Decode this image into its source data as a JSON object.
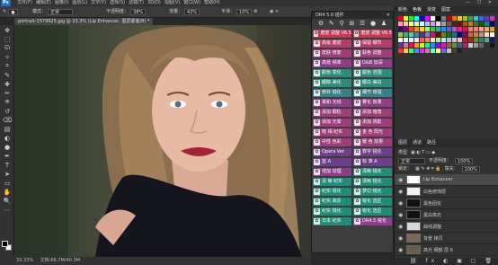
{
  "menubar": {
    "logo": "Ps",
    "items": [
      "文件(F)",
      "编辑(E)",
      "图像(I)",
      "图层(L)",
      "文字(Y)",
      "选择(S)",
      "滤镜(T)",
      "3D(D)",
      "视图(V)",
      "窗口(W)",
      "帮助(H)"
    ],
    "window_controls": "— ☐ ✕"
  },
  "optionsbar": {
    "mode_label": "模式：",
    "mode_value": "正常",
    "opacity_label": "不透明度：",
    "opacity_value": "38%",
    "flow_label": "流量：",
    "flow_value": "42%",
    "smooth_label": "平滑：",
    "smooth_value": "10%"
  },
  "document": {
    "tab_title": "portrait-1579925.jpg @ 33.3% (Lip Enhancer, 图层蒙版/8) *",
    "status_zoom": "33.33%",
    "status_doc": "文档:66.7M/40.3M"
  },
  "toolbar": {
    "tools": [
      "move-tool",
      "marquee-tool",
      "lasso-tool",
      "magic-wand-tool",
      "crop-tool",
      "eyedropper-tool",
      "healing-tool",
      "brush-tool",
      "stamp-tool",
      "history-brush-tool",
      "eraser-tool",
      "gradient-tool",
      "blur-tool",
      "dodge-tool",
      "pen-tool",
      "text-tool",
      "path-select-tool",
      "shape-tool",
      "hand-tool",
      "zoom-tool",
      "more-tool"
    ],
    "glyphs": [
      "✥",
      "⬚",
      "ᘏ",
      "✧",
      "⌗",
      "✎",
      "✚",
      "✏",
      "⎈",
      "↺",
      "⌫",
      "▤",
      "◐",
      "●",
      "✒",
      "T",
      "➤",
      "▭",
      "✋",
      "🔍",
      "⋯"
    ]
  },
  "plugin": {
    "title": "DR4 5.0 插件",
    "close": "✕",
    "top_icons": [
      "⚙",
      "✎",
      "⚲",
      "⊞",
      "☰",
      "●",
      "♟"
    ],
    "buttons": [
      {
        "label": "磨皮 调整 V6.5",
        "icon": "✿",
        "color": "#c03a58"
      },
      {
        "label": "磨皮 调整 V6.5",
        "icon": "✿",
        "color": "#c03a58"
      },
      {
        "label": "高级 磨皮",
        "icon": "✿",
        "color": "#b33d6a"
      },
      {
        "label": "保留 细节",
        "icon": "✿",
        "color": "#b33d6a"
      },
      {
        "label": "皮肤 修复",
        "icon": "✿",
        "color": "#9d3d7a"
      },
      {
        "label": "肤色 调整",
        "icon": "✿",
        "color": "#9d3d7a"
      },
      {
        "label": "高低 频率",
        "icon": "✿",
        "color": "#8e3e86"
      },
      {
        "label": "D&B 加深",
        "icon": "✿",
        "color": "#8e3e86"
      },
      {
        "label": "颜色 变化",
        "icon": "✿",
        "color": "#2a8d7c"
      },
      {
        "label": "颜色 范围",
        "icon": "✿",
        "color": "#2a8d7c"
      },
      {
        "label": "眼睛 美化",
        "icon": "✿",
        "color": "#2a8d7c"
      },
      {
        "label": "眼白 美白",
        "icon": "✿",
        "color": "#2a8d7c"
      },
      {
        "label": "修补 锐化",
        "icon": "✿",
        "color": "#3a7f87"
      },
      {
        "label": "细节 增强",
        "icon": "✿",
        "color": "#3a7f87"
      },
      {
        "label": "柔和 光线",
        "icon": "✿",
        "color": "#8e3e86"
      },
      {
        "label": "雾化 效果",
        "icon": "✿",
        "color": "#8e3e86"
      },
      {
        "label": "添加 颗粒",
        "icon": "✿",
        "color": "#9d3d7a"
      },
      {
        "label": "添加 暗角",
        "icon": "✿",
        "color": "#9d3d7a"
      },
      {
        "label": "添加 光晕",
        "icon": "✿",
        "color": "#9d3d7a"
      },
      {
        "label": "添加 阴影",
        "icon": "✿",
        "color": "#9d3d7a"
      },
      {
        "label": "暗 相 纪实",
        "icon": "✿",
        "color": "#9d3d7a"
      },
      {
        "label": "金 色 阳光",
        "icon": "✿",
        "color": "#9d3d7a"
      },
      {
        "label": "中性 色彩",
        "icon": "✿",
        "color": "#9d3d7a"
      },
      {
        "label": "暖 色 效果",
        "icon": "✿",
        "color": "#9d3d7a"
      },
      {
        "label": "Opera Ver",
        "icon": "✿",
        "color": "#6d3f88"
      },
      {
        "label": "数字 锐化",
        "icon": "✿",
        "color": "#6d3f88"
      },
      {
        "label": "蓝 A",
        "icon": "✿",
        "color": "#6d3f88"
      },
      {
        "label": "标 准 A",
        "icon": "✿",
        "color": "#6d3f88"
      },
      {
        "label": "增加 纹理",
        "icon": "✿",
        "color": "#8b3e85"
      },
      {
        "label": "清晰 锐化",
        "icon": "✿",
        "color": "#1f8c76"
      },
      {
        "label": "清 晰 纪实",
        "icon": "✿",
        "color": "#1f8c76"
      },
      {
        "label": "清晰 锐化",
        "icon": "✿",
        "color": "#1f8c76"
      },
      {
        "label": "纪实 锐化",
        "icon": "✿",
        "color": "#1f8c76"
      },
      {
        "label": "梦幻 锐化",
        "icon": "✿",
        "color": "#1f8c76"
      },
      {
        "label": "纪实 高反",
        "icon": "✿",
        "color": "#1f8c76"
      },
      {
        "label": "锐化 选区",
        "icon": "✿",
        "color": "#1f8c76"
      },
      {
        "label": "纪实 锐化",
        "icon": "✿",
        "color": "#1f8c76"
      },
      {
        "label": "锐化 选区",
        "icon": "✿",
        "color": "#1f8c76"
      },
      {
        "label": "日本 纪实",
        "icon": "✿",
        "color": "#1f8c76"
      },
      {
        "label": "DR4.5 锐化",
        "icon": "✿",
        "color": "#8e3e86"
      }
    ]
  },
  "right_panel": {
    "tabs": [
      "颜色",
      "色板",
      "渐变",
      "图案"
    ],
    "active_tab": "色板",
    "swatch_colors": [
      "#ff0000",
      "#ffff00",
      "#00ff00",
      "#00ffff",
      "#0000ff",
      "#ff00ff",
      "#ffffff",
      "#000000",
      "#7f7f7f",
      "#c00000",
      "#ff6600",
      "#ffcc00",
      "#99cc00",
      "#339966",
      "#33cccc",
      "#3366ff",
      "#6633cc",
      "#cc33cc",
      "#ff99cc",
      "#ffcc99",
      "#ffff99",
      "#ccffcc",
      "#ccffff",
      "#99ccff",
      "#cc99ff",
      "#e0e0e0",
      "#a0a0a0",
      "#606060",
      "#303030",
      "#8b0000",
      "#a0522d",
      "#b8860b",
      "#556b2f",
      "#006400",
      "#008b8b",
      "#00008b",
      "#4b0082",
      "#8b008b",
      "#ff4500",
      "#ff8c00",
      "#ffd700",
      "#adff2f",
      "#32cd32",
      "#20b2aa",
      "#1e90ff",
      "#6a5acd",
      "#ba55d3",
      "#ff1493",
      "#dc143c",
      "#f08080",
      "#fa8072",
      "#ffa07a",
      "#f4a460",
      "#daa520",
      "#9acd32",
      "#3cb371",
      "#48d1cc",
      "#4682b4",
      "#483d8b",
      "#9370db",
      "#c71585",
      "#800000",
      "#808000",
      "#008000",
      "#008080",
      "#000080",
      "#800080",
      "#d2691e",
      "#cd853f",
      "#bc8f8f",
      "#f5deb3",
      "#fff8dc",
      "#f0fff0",
      "#e0ffff",
      "#e6e6fa",
      "#ffe4e1",
      "#ff6347",
      "#ff7f50",
      "#eee8aa",
      "#98fb98",
      "#afeeee",
      "#b0c4de",
      "#d8bfd8",
      "#ffb6c1",
      "#b22222",
      "#a52a2a",
      "#6b8e23",
      "#2e8b57",
      "#5f9ea0",
      "#191970",
      "#663399",
      "#db7093",
      "#ff0066",
      "#ff9900",
      "#ccff00",
      "#00ff99",
      "#0099ff",
      "#9900ff",
      "#ff00cc",
      "#996633",
      "#669933",
      "#336699",
      "#993366",
      "#cccccc",
      "#999999",
      "#666666",
      "#333333",
      "#111111",
      "#ff3333",
      "#ffcc33",
      "#33ff66",
      "#3399ff",
      "#cc33ff",
      "#ff6699",
      "#66ffcc",
      "#ffff66",
      "#6666ff",
      "#c0c0c0",
      "#404040",
      "#202020"
    ],
    "layers_tabs": [
      "图层",
      "通道",
      "路径"
    ],
    "kind_label": "类型",
    "blend_mode": "正常",
    "opacity_label": "不透明度：",
    "opacity_value": "100%",
    "lock_label": "锁定：",
    "fill_label": "填充：",
    "fill_value": "100%",
    "layers": [
      {
        "name": "Lip Enhancer",
        "thumb": "#ffffff",
        "selected": true
      },
      {
        "name": "白色修饰层",
        "thumb": "#f0f0f0",
        "selected": false
      },
      {
        "name": "黑色固化",
        "thumb": "#111111",
        "selected": false
      },
      {
        "name": "黑白高光",
        "thumb": "#111111",
        "selected": false
      },
      {
        "name": "曲线调整",
        "thumb": "#d9d9d9",
        "selected": false
      },
      {
        "name": "背景 拷贝",
        "thumb": "#7a6a55",
        "selected": false
      },
      {
        "name": "高光 细部 层 6",
        "thumb": "#6b5e4c",
        "selected": false
      }
    ],
    "bottom_icons": "⛓ fx ◐ ▣ ▢ 🗑"
  }
}
